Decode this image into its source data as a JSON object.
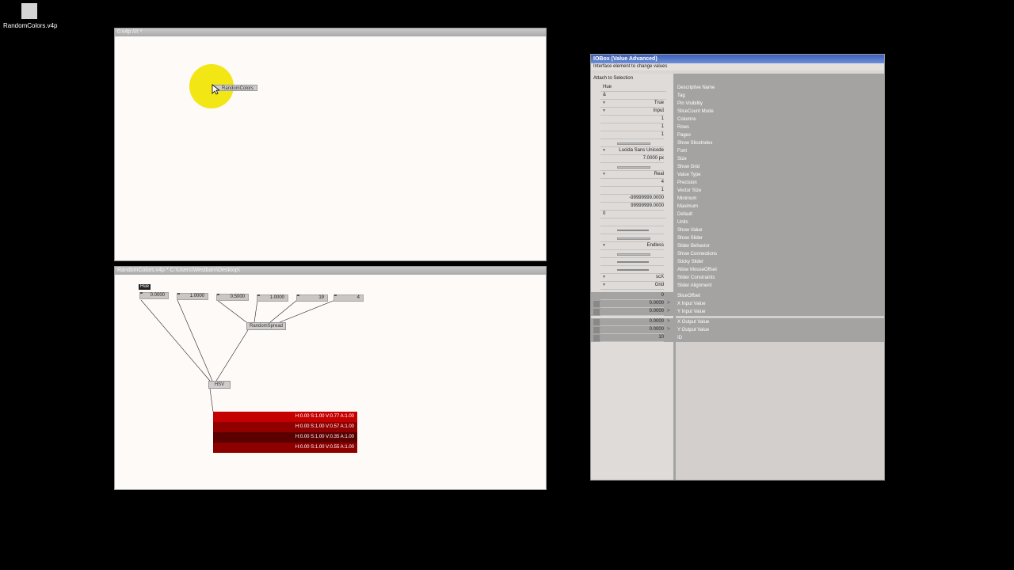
{
  "desktop": {
    "icon_label": "RandomColors.v4p"
  },
  "window_top": {
    "title": "0.v4p //// *",
    "node_label": "RandomColors"
  },
  "window_bottom": {
    "title": "RandomColors.v4p *  C:\\Users\\Westbam\\Desktop\\",
    "hue_tag": "Hue",
    "iobox_values": [
      "0.0000",
      "1.0000",
      "0.5000",
      "1.0000",
      "19",
      "4"
    ],
    "node_random_spread": "RandomSpread",
    "node_hsv": "HSV",
    "colors": [
      {
        "text": "H:0.00  S:1.00  V:0.77  A:1.00",
        "color": "#c40000"
      },
      {
        "text": "H:0.00  S:1.00  V:0.57  A:1.00",
        "color": "#910000"
      },
      {
        "text": "H:0.00  S:1.00  V:0.35  A:1.00",
        "color": "#5a0000"
      },
      {
        "text": "H:0.00  S:1.00  V:0.55  A:1.00",
        "color": "#8c0000"
      }
    ]
  },
  "inspector": {
    "title": "IOBox (Value Advanced)",
    "subtitle": "Interface element to change values",
    "attach": "Attach to Selection",
    "rows": [
      {
        "value": "Hue",
        "label": "Descriptive Name",
        "kind": "text-left"
      },
      {
        "value": "&",
        "label": "Tag",
        "kind": "text-left"
      },
      {
        "value": "True",
        "label": "Pin Visibility",
        "kind": "enum"
      },
      {
        "value": "Input",
        "label": "SliceCount Mode",
        "kind": "enum"
      },
      {
        "value": "1",
        "label": "Columns",
        "kind": "num"
      },
      {
        "value": "1",
        "label": "Rows",
        "kind": "num"
      },
      {
        "value": "1",
        "label": "Pages",
        "kind": "num"
      },
      {
        "value": "",
        "label": "Show SliceIndex",
        "kind": "bar-light"
      },
      {
        "value": "Lucida Sans Unicode",
        "label": "Font",
        "kind": "enum"
      },
      {
        "value": "7.0000 px",
        "label": "Size",
        "kind": "num"
      },
      {
        "value": "",
        "label": "Show Grid",
        "kind": "bar-light"
      },
      {
        "value": "Real",
        "label": "Value Type",
        "kind": "enum"
      },
      {
        "value": "4",
        "label": "Precision",
        "kind": "num"
      },
      {
        "value": "1",
        "label": "Vector Size",
        "kind": "num"
      },
      {
        "value": "-99999999.0000",
        "label": "Minimum",
        "kind": "num"
      },
      {
        "value": "99999999.0000",
        "label": "Maximum",
        "kind": "num"
      },
      {
        "value": "0",
        "label": "Default",
        "kind": "text-left"
      },
      {
        "value": "",
        "label": "Units",
        "kind": "empty"
      },
      {
        "value": "",
        "label": "Show Value",
        "kind": "bar"
      },
      {
        "value": "",
        "label": "Show Slider",
        "kind": "bar-light"
      },
      {
        "value": "Endless",
        "label": "Slider Behavior",
        "kind": "enum"
      },
      {
        "value": "",
        "label": "Show Connections",
        "kind": "bar-light"
      },
      {
        "value": "",
        "label": "Sticky Slider",
        "kind": "bar"
      },
      {
        "value": "",
        "label": "Allow MouseOffset",
        "kind": "bar"
      },
      {
        "value": "scX",
        "label": "Slider Constraints",
        "kind": "enum"
      },
      {
        "value": "Grid",
        "label": "Slider Alignment",
        "kind": "enum"
      }
    ],
    "input_rows": [
      {
        "value": "0",
        "label": "SliceOffset",
        "gt": ""
      },
      {
        "value": "0.0000",
        "label": "X Input Value",
        "gt": ">"
      },
      {
        "value": "0.0000",
        "label": "Y Input Value",
        "gt": ">"
      }
    ],
    "output_rows": [
      {
        "value": "0.0000",
        "label": "X Output Value",
        "gt": ">"
      },
      {
        "value": "0.0000",
        "label": "Y Output Value",
        "gt": ">"
      },
      {
        "value": "10",
        "label": "ID",
        "gt": ""
      }
    ]
  }
}
